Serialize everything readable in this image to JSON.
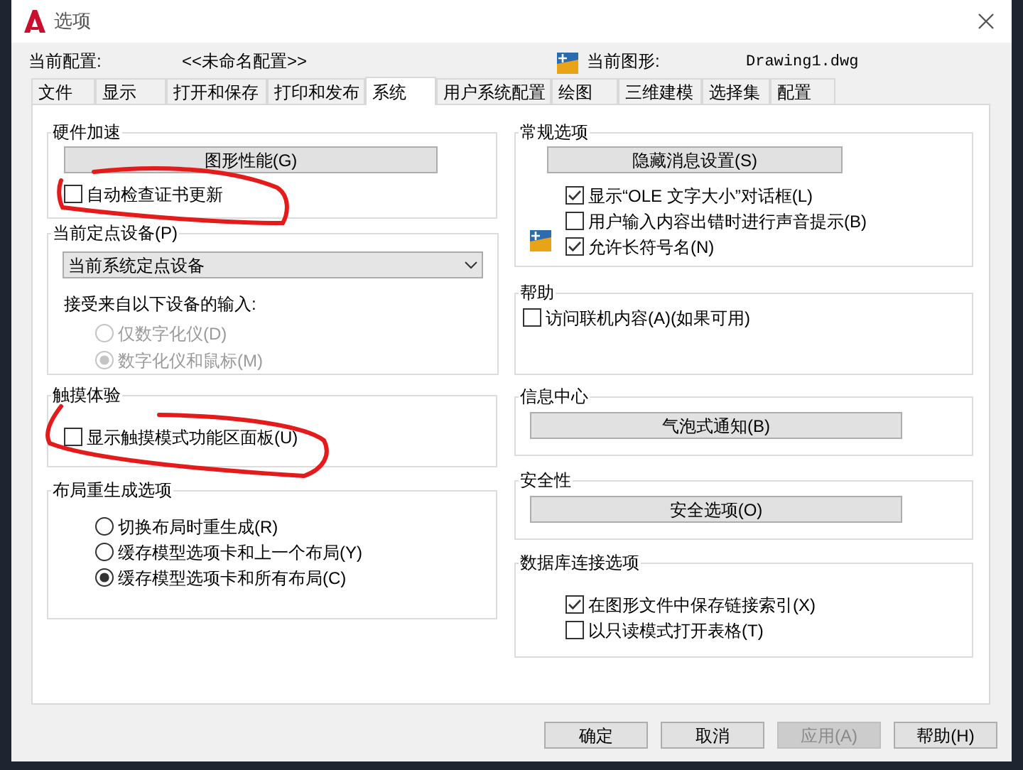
{
  "window": {
    "title": "选项"
  },
  "header": {
    "profile_label": "当前配置:",
    "profile_value": "<<未命名配置>>",
    "drawing_label": "当前图形:",
    "drawing_value": "Drawing1.dwg"
  },
  "tabs": [
    {
      "label": "文件",
      "selected": false
    },
    {
      "label": "显示",
      "selected": false
    },
    {
      "label": "打开和保存",
      "selected": false
    },
    {
      "label": "打印和发布",
      "selected": false
    },
    {
      "label": "系统",
      "selected": true
    },
    {
      "label": "用户系统配置",
      "selected": false
    },
    {
      "label": "绘图",
      "selected": false
    },
    {
      "label": "三维建模",
      "selected": false
    },
    {
      "label": "选择集",
      "selected": false
    },
    {
      "label": "配置",
      "selected": false
    }
  ],
  "left_groups": [
    {
      "title": "硬件加速",
      "items": [
        {
          "kind": "button",
          "label": "图形性能(G)"
        },
        {
          "kind": "checkbox",
          "label": "自动检查证书更新",
          "checked": false
        }
      ]
    },
    {
      "title": "当前定点设备(P)",
      "items": [
        {
          "kind": "select",
          "value": "当前系统定点设备"
        },
        {
          "kind": "label",
          "label": "接受来自以下设备的输入:"
        },
        {
          "kind": "radio",
          "label": "仅数字化仪(D)",
          "selected": false,
          "disabled": true
        },
        {
          "kind": "radio",
          "label": "数字化仪和鼠标(M)",
          "selected": true,
          "disabled": true
        }
      ]
    },
    {
      "title": "触摸体验",
      "items": [
        {
          "kind": "checkbox",
          "label": "显示触摸模式功能区面板(U)",
          "checked": false
        }
      ]
    },
    {
      "title": "布局重生成选项",
      "items": [
        {
          "kind": "radio",
          "label": "切换布局时重生成(R)",
          "selected": false,
          "disabled": false
        },
        {
          "kind": "radio",
          "label": "缓存模型选项卡和上一个布局(Y)",
          "selected": false,
          "disabled": false
        },
        {
          "kind": "radio",
          "label": "缓存模型选项卡和所有布局(C)",
          "selected": true,
          "disabled": false
        }
      ]
    }
  ],
  "right_groups": [
    {
      "title": "常规选项",
      "items": [
        {
          "kind": "button",
          "label": "隐藏消息设置(S)"
        },
        {
          "kind": "checkbox",
          "label": "显示“OLE 文字大小”对话框(L)",
          "checked": true
        },
        {
          "kind": "checkbox",
          "label": "用户输入内容出错时进行声音提示(B)",
          "checked": false
        },
        {
          "kind": "checkbox",
          "label": "允许长符号名(N)",
          "checked": true,
          "has_icon": true
        }
      ]
    },
    {
      "title": "帮助",
      "items": [
        {
          "kind": "checkbox",
          "label": "访问联机内容(A)(如果可用)",
          "checked": false
        }
      ]
    },
    {
      "title": "信息中心",
      "items": [
        {
          "kind": "button",
          "label": "气泡式通知(B)"
        }
      ]
    },
    {
      "title": "安全性",
      "items": [
        {
          "kind": "button",
          "label": "安全选项(O)"
        }
      ]
    },
    {
      "title": "数据库连接选项",
      "items": [
        {
          "kind": "checkbox",
          "label": "在图形文件中保存链接索引(X)",
          "checked": true
        },
        {
          "kind": "checkbox",
          "label": "以只读模式打开表格(T)",
          "checked": false
        }
      ]
    }
  ],
  "buttons": [
    {
      "label": "确定",
      "disabled": false
    },
    {
      "label": "取消",
      "disabled": false
    },
    {
      "label": "应用(A)",
      "disabled": true
    },
    {
      "label": "帮助(H)",
      "disabled": false
    }
  ]
}
